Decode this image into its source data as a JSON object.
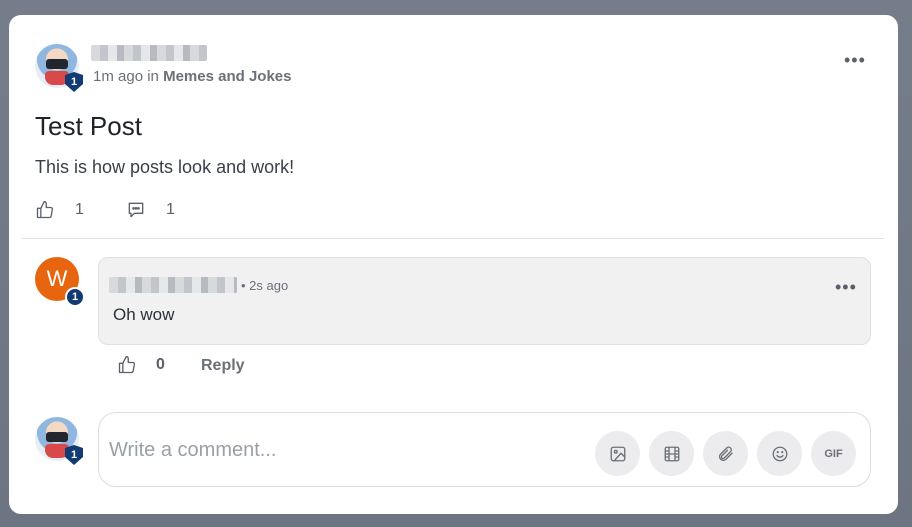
{
  "post": {
    "time_ago": "1m ago",
    "in_word": "in",
    "community": "Memes and Jokes",
    "title": "Test Post",
    "body": "This is how posts look and work!",
    "like_count": "1",
    "comment_count": "1",
    "author_rank": "1"
  },
  "comment": {
    "avatar_letter": "W",
    "author_rank": "1",
    "time": "• 2s ago",
    "text": "Oh wow",
    "like_count": "0",
    "reply_label": "Reply"
  },
  "composer": {
    "placeholder": "Write a comment...",
    "user_rank": "1",
    "tools": [
      "image-icon",
      "video-icon",
      "attachment-icon",
      "emoji-icon",
      "gif-icon"
    ],
    "gif_label": "GIF"
  },
  "more_label": "•••",
  "colors": {
    "accent_badge": "#123a73",
    "comment_avatar": "#e8650f",
    "backdrop": "#6c7382"
  }
}
